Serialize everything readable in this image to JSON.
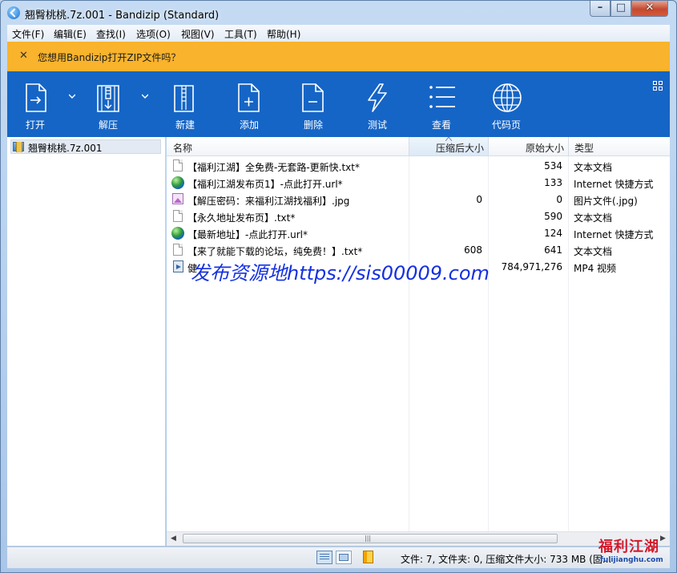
{
  "window": {
    "title": "翘臀桃桃.7z.001 - Bandizip (Standard)",
    "controls": {
      "minimize": "–",
      "maximize": "□",
      "close": "✕"
    }
  },
  "menubar": {
    "items": [
      "文件(F)",
      "编辑(E)",
      "查找(I)",
      "选项(O)",
      "视图(V)",
      "工具(T)",
      "帮助(H)"
    ]
  },
  "notice": {
    "close_glyph": "✕",
    "text": "您想用Bandizip打开ZIP文件吗？"
  },
  "toolbar": {
    "open_label": "打开",
    "extract_label": "解压",
    "new_label": "新建",
    "add_label": "添加",
    "delete_label": "删除",
    "test_label": "测试",
    "view_label": "查看",
    "codepage_label": "代码页"
  },
  "tree": {
    "root_label": "翘臀桃桃.7z.001"
  },
  "columns": {
    "name": "名称",
    "compressed": "压缩后大小",
    "original": "原始大小",
    "type": "类型"
  },
  "files": [
    {
      "icon": "text-file-icon",
      "name": "【福利江湖】全免费-无套路-更新快.txt*",
      "compressed": "",
      "original": "534",
      "type": "文本文档"
    },
    {
      "icon": "internet-shortcut-icon",
      "name": "【福利江湖发布页1】-点此打开.url*",
      "compressed": "",
      "original": "133",
      "type": "Internet 快捷方式"
    },
    {
      "icon": "image-file-icon",
      "name": "【解压密码：来福利江湖找福利】.jpg",
      "compressed": "0",
      "original": "0",
      "type": "图片文件(.jpg)"
    },
    {
      "icon": "text-file-icon",
      "name": "【永久地址发布页】.txt*",
      "compressed": "",
      "original": "590",
      "type": "文本文档"
    },
    {
      "icon": "internet-shortcut-icon",
      "name": "【最新地址】-点此打开.url*",
      "compressed": "",
      "original": "124",
      "type": "Internet 快捷方式"
    },
    {
      "icon": "text-file-icon",
      "name": "【来了就能下载的论坛，纯免费！】.txt*",
      "compressed": "608",
      "original": "641",
      "type": "文本文档"
    },
    {
      "icon": "video-file-icon",
      "name": "健",
      "compressed": "",
      "original": "784,971,276",
      "type": "MP4 视频"
    }
  ],
  "overlay": {
    "watermark": "发布资源地https://sis00009.com"
  },
  "scrollbar": {
    "grip": "|||"
  },
  "statusbar": {
    "text": "文件: 7, 文件夹: 0, 压缩文件大小: 733 MB (固..."
  },
  "corner_logo": {
    "main": "福利江湖",
    "sub": "fulijianghu.com"
  }
}
